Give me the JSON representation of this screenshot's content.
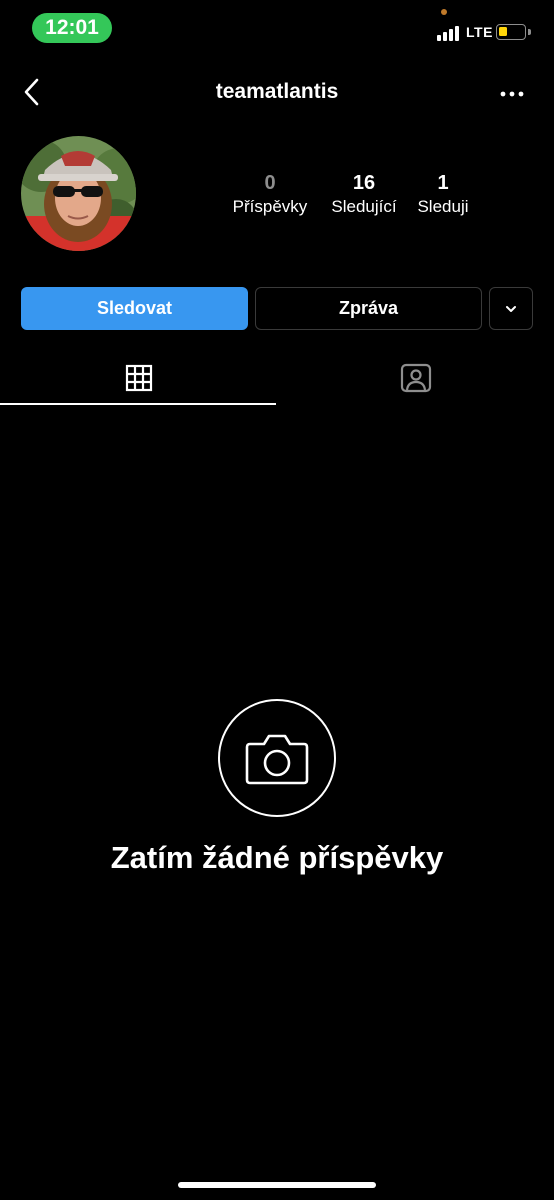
{
  "status_bar": {
    "time": "12:01",
    "network": "LTE",
    "battery_level": 0.35,
    "colors": {
      "time_pill": "#34c759",
      "battery": "#ffd60a"
    }
  },
  "header": {
    "username": "teamatlantis",
    "back_icon": "chevron-left-icon",
    "more_icon": "ellipsis-icon"
  },
  "profile": {
    "stats": [
      {
        "value": "0",
        "label": "Příspěvky"
      },
      {
        "value": "16",
        "label": "Sledující"
      },
      {
        "value": "1",
        "label": "Sleduji"
      }
    ]
  },
  "actions": {
    "follow_label": "Sledovat",
    "message_label": "Zpráva",
    "more_icon": "chevron-down-icon",
    "accent": "#3897f0"
  },
  "tabs": [
    {
      "icon": "grid-icon",
      "active": true
    },
    {
      "icon": "tagged-person-icon",
      "active": false
    }
  ],
  "empty_state": {
    "icon": "camera-icon",
    "title": "Zatím žádné příspěvky"
  }
}
